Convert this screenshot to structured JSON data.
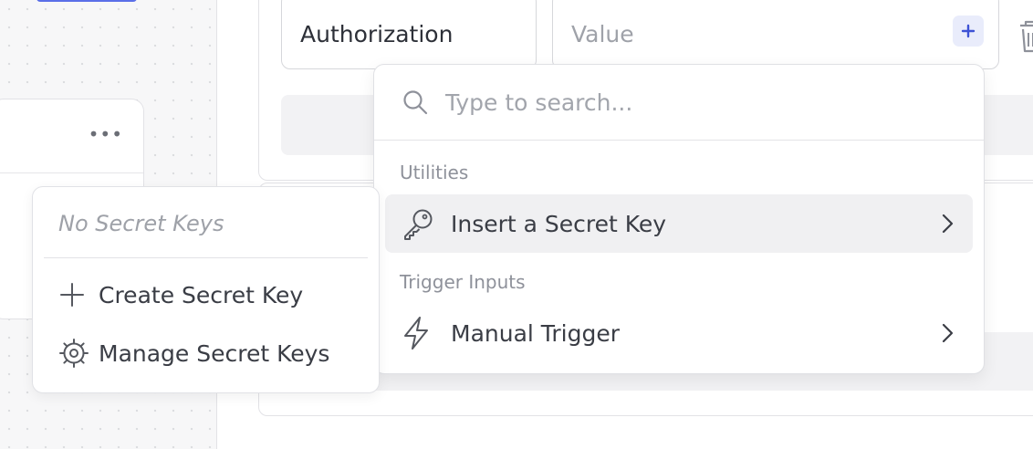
{
  "header_field": {
    "name_value": "Authorization",
    "value_placeholder": "Value"
  },
  "node": {
    "more_label": "•••"
  },
  "search": {
    "placeholder": "Type to search..."
  },
  "groups": [
    {
      "label": "Utilities",
      "items": [
        {
          "label": "Insert a Secret Key",
          "icon": "key-icon"
        }
      ]
    },
    {
      "label": "Trigger Inputs",
      "items": [
        {
          "label": "Manual Trigger",
          "icon": "lightning-icon"
        }
      ]
    }
  ],
  "secret_menu": {
    "empty_text": "No Secret Keys",
    "create_label": "Create Secret Key",
    "manage_label": "Manage Secret Keys"
  },
  "colors": {
    "accent": "#5b6fe8",
    "plus_bg": "#e9ecfb",
    "active_row": "#f0f0f2"
  }
}
